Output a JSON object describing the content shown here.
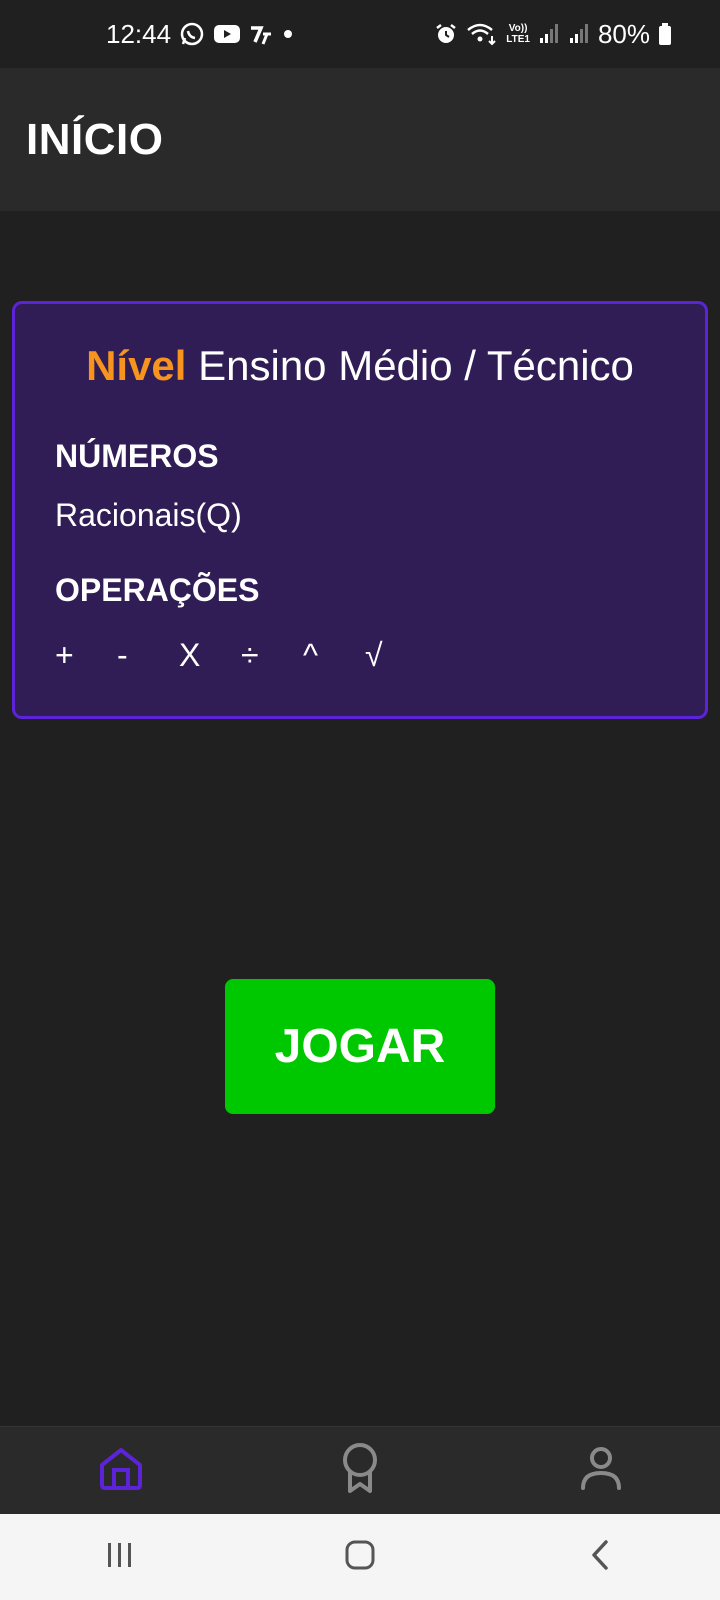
{
  "status_bar": {
    "time": "12:44",
    "battery": "80%",
    "left_icons": [
      "whatsapp-icon",
      "youtube-icon",
      "app-icon",
      "dot-icon"
    ],
    "right_icons": [
      "alarm-icon",
      "wifi-icon",
      "volte-icon",
      "signal-icon",
      "signal-icon",
      "battery-icon"
    ],
    "volte_label_top": "Vo))",
    "volte_label_bottom": "LTE1"
  },
  "app_bar": {
    "title": "INÍCIO"
  },
  "level_card": {
    "level_label": "Nível",
    "level_value": "Ensino Médio / Técnico",
    "numbers_title": "NÚMEROS",
    "numbers_value": "Racionais(Q)",
    "operations_title": "OPERAÇÕES",
    "operations": [
      "+",
      "-",
      "X",
      "÷",
      "^",
      "√"
    ]
  },
  "play_button": {
    "label": "JOGAR"
  },
  "bottom_nav": {
    "items": [
      {
        "icon": "home-icon",
        "active": true
      },
      {
        "icon": "medal-icon",
        "active": false
      },
      {
        "icon": "profile-icon",
        "active": false
      }
    ]
  },
  "colors": {
    "accent": "#5c23d8",
    "level_label": "#f7941d",
    "card_bg": "#311d56",
    "play_button": "#00c800",
    "background": "#202020"
  }
}
